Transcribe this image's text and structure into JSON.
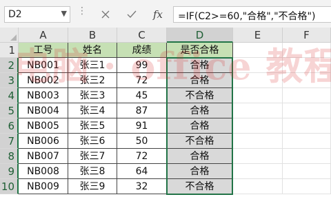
{
  "namebox": {
    "value": "D2"
  },
  "formula_bar": {
    "formula": "=IF(C2>=60,\"合格\",\"不合格\")"
  },
  "watermark": {
    "text": "电脑 · office 教程网"
  },
  "columns": [
    "A",
    "B",
    "C",
    "D",
    "E",
    "F"
  ],
  "rows": [
    "1",
    "2",
    "3",
    "4",
    "5",
    "6",
    "7",
    "8",
    "9",
    "10"
  ],
  "table": {
    "headers": [
      "工号",
      "姓名",
      "成绩",
      "是否合格"
    ],
    "rows": [
      [
        "NB001",
        "张三1",
        "99",
        "合格"
      ],
      [
        "NB002",
        "张三2",
        "72",
        "合格"
      ],
      [
        "NB003",
        "张三3",
        "45",
        "不合格"
      ],
      [
        "NB004",
        "张三4",
        "87",
        "合格"
      ],
      [
        "NB005",
        "张三5",
        "91",
        "合格"
      ],
      [
        "NB006",
        "张三6",
        "50",
        "不合格"
      ],
      [
        "NB007",
        "张三7",
        "72",
        "合格"
      ],
      [
        "NB008",
        "张三8",
        "64",
        "合格"
      ],
      [
        "NB009",
        "张三9",
        "32",
        "不合格"
      ]
    ]
  },
  "colors": {
    "header_fill": "#c6e0b4",
    "selection_fill": "#d9d9d9",
    "selection_border": "#217346"
  }
}
